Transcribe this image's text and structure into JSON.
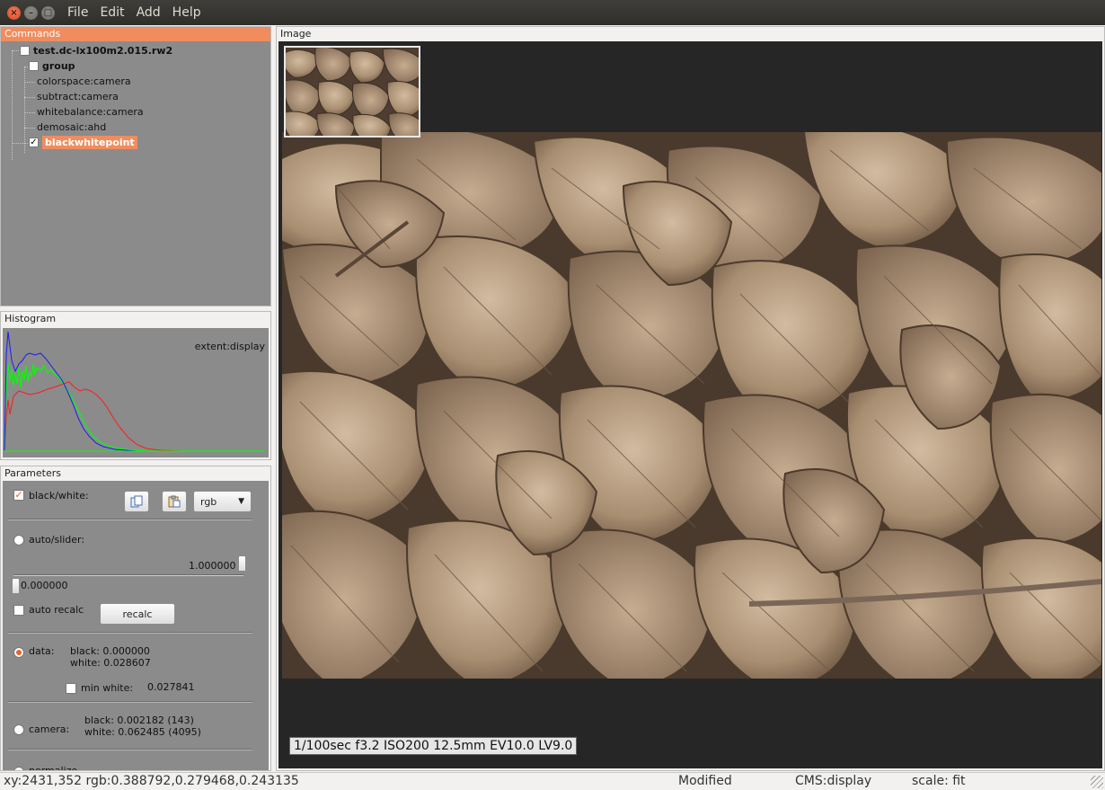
{
  "window": {
    "menu": [
      "File",
      "Edit",
      "Add",
      "Help"
    ]
  },
  "commands": {
    "header": "Commands",
    "file": "test.dc-lx100m2.015.rw2",
    "group": "group",
    "items": [
      "colorspace:camera",
      "subtract:camera",
      "whitebalance:camera",
      "demosaic:ahd"
    ],
    "selected": "blackwhitepoint"
  },
  "histogram": {
    "header": "Histogram",
    "extent": "extent:display",
    "colors": {
      "red": "#ff1a1a",
      "green": "#00ff00",
      "blue": "#1a1aff"
    }
  },
  "parameters": {
    "header": "Parameters",
    "black_white_label": "black/white:",
    "channel_select": "rgb",
    "auto_slider_label": "auto/slider:",
    "slider_max_value": "1.000000",
    "slider_min_value": "0.000000",
    "auto_recalc_label": "auto recalc",
    "recalc_button": "recalc",
    "data_label": "data:",
    "data_black": "black: 0.000000",
    "data_white": "white: 0.028607",
    "min_white_label": "min white:",
    "min_white_value": "0.027841",
    "camera_label": "camera:",
    "camera_black": "black: 0.002182 (143)",
    "camera_white": "white: 0.062485 (4095)",
    "normalize_label": "normalize"
  },
  "image": {
    "header": "Image",
    "exif": "1/100sec  f3.2  ISO200  12.5mm  EV10.0 LV9.0"
  },
  "status": {
    "coords": "xy:2431,352 rgb:0.388792,0.279468,0.243135",
    "modified": "Modified",
    "cms": "CMS:display",
    "scale": "scale: fit"
  }
}
